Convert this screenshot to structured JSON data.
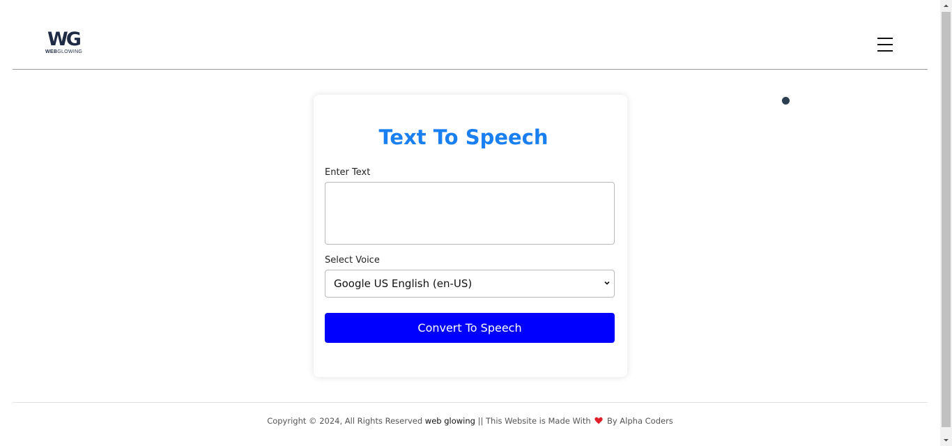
{
  "header": {
    "logo_mark": "WG",
    "logo_word_bold": "WEB",
    "logo_word_rest": "GLOWING",
    "menu_icon": "hamburger-icon"
  },
  "card": {
    "title": "Text To Speech",
    "text_label": "Enter Text",
    "text_value": "",
    "text_placeholder": "",
    "voice_label": "Select Voice",
    "voice_selected": "Google US English (en-US)",
    "convert_label": "Convert To Speech"
  },
  "footer": {
    "copyright": "Copyright © 2024, All Rights Reserved",
    "site_link": "web glowing",
    "separator": "||",
    "made_with": "This Website is Made With",
    "heart_icon": "heart-icon",
    "by": "By Alpha Coders"
  },
  "colors": {
    "title": "#1a7ff0",
    "button": "#0000ff",
    "heart": "#e0202a",
    "dot": "#2c3e50"
  }
}
